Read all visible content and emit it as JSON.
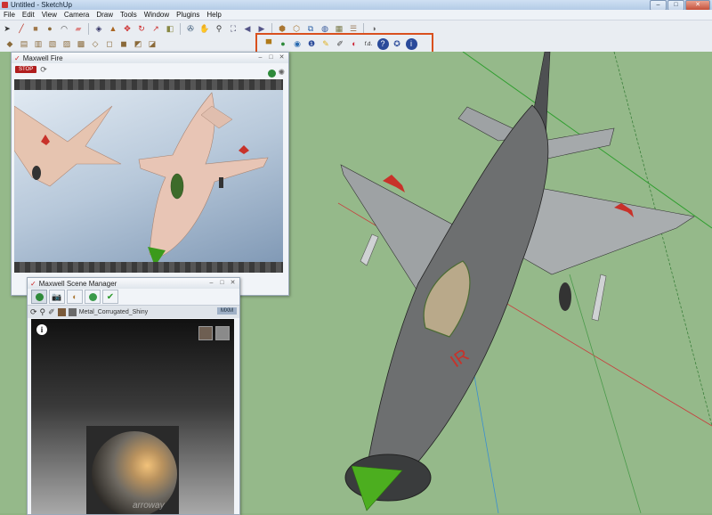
{
  "window": {
    "title": "Untitled - SketchUp"
  },
  "window_controls": {
    "minimize": "–",
    "maximize": "□",
    "close": "✕"
  },
  "menu": [
    "File",
    "Edit",
    "View",
    "Camera",
    "Draw",
    "Tools",
    "Window",
    "Plugins",
    "Help"
  ],
  "toolbar_row1": [
    {
      "icon": "select-arrow-icon",
      "glyph": "➤",
      "color": "#333"
    },
    {
      "icon": "pencil-line-icon",
      "glyph": "╱",
      "color": "#b32"
    },
    {
      "icon": "rectangle-icon",
      "glyph": "■",
      "color": "#a0784a"
    },
    {
      "icon": "circle-icon",
      "glyph": "●",
      "color": "#8b6a3a"
    },
    {
      "icon": "arc-icon",
      "glyph": "◠",
      "color": "#444"
    },
    {
      "icon": "eraser-icon",
      "glyph": "▰",
      "color": "#d88"
    },
    {
      "icon": "paint-bucket-icon",
      "glyph": "◈",
      "color": "#336"
    },
    {
      "icon": "push-pull-icon",
      "glyph": "▲",
      "color": "#a62"
    },
    {
      "icon": "move-icon",
      "glyph": "✥",
      "color": "#c22"
    },
    {
      "icon": "rotate-icon",
      "glyph": "↻",
      "color": "#c22"
    },
    {
      "icon": "follow-me-icon",
      "glyph": "↗",
      "color": "#c33"
    },
    {
      "icon": "offset-icon",
      "glyph": "◧",
      "color": "#884"
    },
    {
      "icon": "orbit-icon",
      "glyph": "✇",
      "color": "#246"
    },
    {
      "icon": "pan-icon",
      "glyph": "✋",
      "color": "#555"
    },
    {
      "icon": "zoom-icon",
      "glyph": "⚲",
      "color": "#333"
    },
    {
      "icon": "zoom-extents-icon",
      "glyph": "⛶",
      "color": "#335"
    },
    {
      "icon": "previous-view-icon",
      "glyph": "◀",
      "color": "#558"
    },
    {
      "icon": "next-view-icon",
      "glyph": "▶",
      "color": "#558"
    },
    {
      "icon": "get-models-icon",
      "glyph": "⬢",
      "color": "#a73"
    },
    {
      "icon": "share-model-icon",
      "glyph": "⬡",
      "color": "#a73"
    },
    {
      "icon": "components-icon",
      "glyph": "⧉",
      "color": "#36a"
    },
    {
      "icon": "google-earth-icon",
      "glyph": "◍",
      "color": "#359"
    },
    {
      "icon": "photo-texture-icon",
      "glyph": "▦",
      "color": "#774"
    },
    {
      "icon": "layers-icon",
      "glyph": "☰",
      "color": "#975"
    },
    {
      "icon": "shadow-icon",
      "glyph": "◑",
      "color": "#666"
    }
  ],
  "toolbar_row2_left": [
    {
      "icon": "iso-view-icon",
      "glyph": "◆",
      "color": "#8a6a3a"
    },
    {
      "icon": "top-view-icon",
      "glyph": "▤",
      "color": "#8a6a3a"
    },
    {
      "icon": "front-view-icon",
      "glyph": "▥",
      "color": "#8a6a3a"
    },
    {
      "icon": "right-view-icon",
      "glyph": "▧",
      "color": "#8a6a3a"
    },
    {
      "icon": "back-view-icon",
      "glyph": "▨",
      "color": "#8a6a3a"
    },
    {
      "icon": "left-view-icon",
      "glyph": "▩",
      "color": "#8a6a3a"
    },
    {
      "icon": "xray-icon",
      "glyph": "◇",
      "color": "#8a6a3a"
    },
    {
      "icon": "wireframe-icon",
      "glyph": "◻",
      "color": "#8a6a3a"
    },
    {
      "icon": "hidden-line-icon",
      "glyph": "◼",
      "color": "#8a6a3a"
    },
    {
      "icon": "shaded-icon",
      "glyph": "◩",
      "color": "#8a6a3a"
    },
    {
      "icon": "textured-icon",
      "glyph": "◪",
      "color": "#8a6a3a"
    }
  ],
  "toolbar_row2_maxwell": [
    {
      "icon": "maxwell-render-icon",
      "glyph": "▀",
      "color": "#b07a1a"
    },
    {
      "icon": "maxwell-fire-icon",
      "glyph": "●",
      "color": "#2e8a3a"
    },
    {
      "icon": "maxwell-studio-icon",
      "glyph": "◉",
      "color": "#2a6ab0"
    },
    {
      "icon": "maxwell-scene-manager-icon",
      "glyph": "❶",
      "color": "#2a4a9a"
    },
    {
      "icon": "maxwell-pencil-icon",
      "glyph": "✎",
      "color": "#e0b020"
    },
    {
      "icon": "maxwell-eyedropper-icon",
      "glyph": "✐",
      "color": "#444"
    },
    {
      "icon": "maxwell-material-icon",
      "glyph": "◐",
      "color": "#c23"
    },
    {
      "icon": "maxwell-focal-icon",
      "glyph": "f.d.",
      "color": "#222"
    },
    {
      "icon": "maxwell-help-icon",
      "glyph": "?",
      "color": "#fff"
    },
    {
      "icon": "maxwell-update-icon",
      "glyph": "✪",
      "color": "#2a4a9a"
    },
    {
      "icon": "maxwell-about-icon",
      "glyph": "i",
      "color": "#fff"
    }
  ],
  "fire": {
    "title": "Maxwell Fire",
    "stop": "STOP",
    "status": "STOP"
  },
  "scene_manager": {
    "title": "Maxwell Scene Manager",
    "material_name": "Metal_Corrugated_Shiny",
    "mxm_label": "MXM",
    "watermark": "arroway"
  },
  "colors": {
    "highlight": "#d9501e",
    "viewport": "#95b98a",
    "jet_gray": "#6d6f70",
    "jet_wing": "#9ea2a4",
    "nose_green": "#4cae1f",
    "red_star": "#c8322a",
    "axis_green": "#2f9e2f",
    "axis_red": "#c93c3c"
  }
}
